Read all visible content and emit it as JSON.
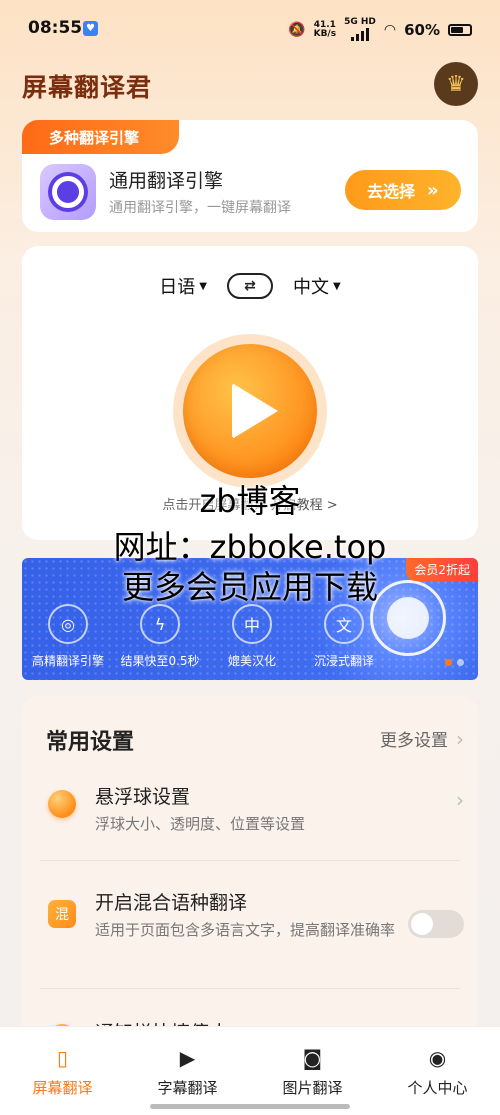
{
  "status_bar": {
    "time": "08:55",
    "net_speed_value": "41.1",
    "net_speed_unit": "KB/s",
    "network": "5G HD",
    "battery": "60%"
  },
  "header": {
    "title": "屏幕翻译君"
  },
  "engine": {
    "tag": "多种翻译引擎",
    "name": "通用翻译引擎",
    "desc": "通用翻译引擎，一键屏幕翻译",
    "choose_label": "去选择"
  },
  "translate": {
    "source_lang": "日语",
    "target_lang": "中文",
    "hint_text": "点击开启屏幕翻译",
    "tutorial_link": "开启教程 >"
  },
  "watermark": {
    "line1": "zb博客",
    "line2": "网址：zbboke.top",
    "line3": "更多会员应用下载"
  },
  "banner": {
    "badge": "会员2折起",
    "features": [
      {
        "label": "高精翻译引擎",
        "icon": "target-icon"
      },
      {
        "label": "结果快至0.5秒",
        "icon": "lightning-icon"
      },
      {
        "label": "媲美汉化",
        "icon": "chinese-char-icon"
      },
      {
        "label": "沉浸式翻译",
        "icon": "translate-icon"
      }
    ]
  },
  "settings": {
    "title": "常用设置",
    "more_label": "更多设置",
    "items": [
      {
        "name": "悬浮球设置",
        "desc": "浮球大小、透明度、位置等设置"
      },
      {
        "name": "开启混合语种翻译",
        "desc": "适用于页面包含多语言文字，提高翻译准确率",
        "icon_text": "混",
        "enabled": false
      },
      {
        "name": "通知栏快捷停止"
      }
    ]
  },
  "tabbar": {
    "tabs": [
      {
        "label": "屏幕翻译",
        "active": true
      },
      {
        "label": "字幕翻译",
        "active": false
      },
      {
        "label": "图片翻译",
        "active": false
      },
      {
        "label": "个人中心",
        "active": false
      }
    ]
  },
  "colors": {
    "accent": "#ff7a14",
    "title_brown": "#7a2e10",
    "banner_blue": "#3f6cf0"
  }
}
